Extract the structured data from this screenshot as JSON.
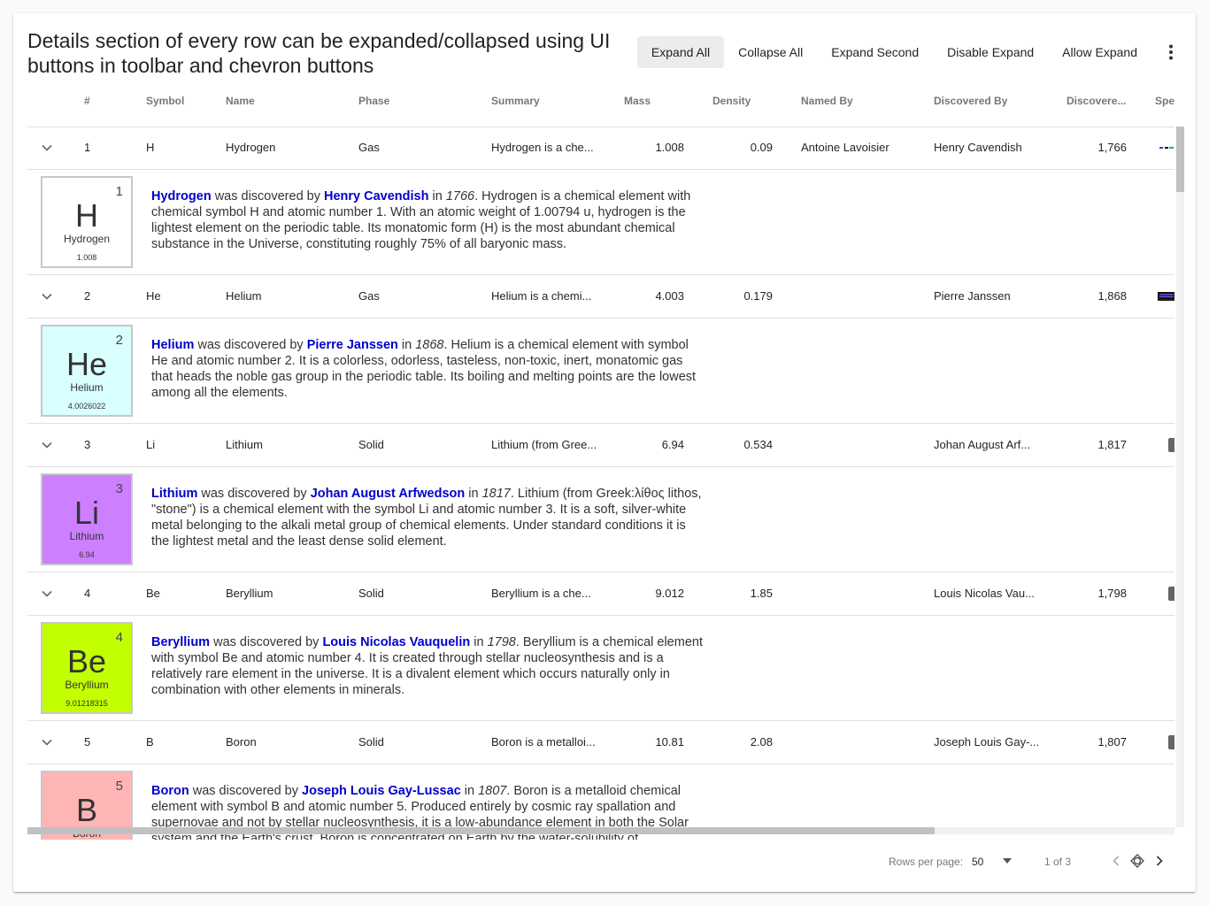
{
  "header": {
    "title": "Details section of every row can be expanded/collapsed using UI buttons in toolbar and chevron buttons"
  },
  "toolbar": {
    "expand_all": "Expand All",
    "collapse_all": "Collapse All",
    "expand_second": "Expand Second",
    "disable_expand": "Disable Expand",
    "allow_expand": "Allow Expand",
    "more_icon": "more-vert-icon"
  },
  "columns": {
    "number": "#",
    "symbol": "Symbol",
    "name": "Name",
    "phase": "Phase",
    "summary": "Summary",
    "mass": "Mass",
    "density": "Density",
    "named_by": "Named By",
    "discovered_by": "Discovered By",
    "discovered": "Discovere...",
    "spectrum": "Spe"
  },
  "rows": [
    {
      "number": "1",
      "symbol": "H",
      "name": "Hydrogen",
      "phase": "Gas",
      "summary": "Hydrogen is a che...",
      "mass": "1.008",
      "density": "0.09",
      "named_by": "Antoine Lavoisier",
      "discovered_by": "Henry Cavendish",
      "year": "1,766",
      "tile": {
        "number": "1",
        "symbol": "H",
        "name": "Hydrogen",
        "mass": "1.008",
        "color": "#ffffff"
      },
      "detail": {
        "element": "Hydrogen",
        "w1": " was discovered by ",
        "discoverer": "Henry Cavendish",
        "w2": " in ",
        "year": "1766",
        "rest": ". Hydrogen is a chemical element with chemical symbol H and atomic number 1. With an atomic weight of 1.00794 u, hydrogen is the lightest element on the periodic table. Its monatomic form (H) is the most abundant chemical substance in the Universe, constituting roughly 75% of all baryonic mass."
      }
    },
    {
      "number": "2",
      "symbol": "He",
      "name": "Helium",
      "phase": "Gas",
      "summary": "Helium is a chemi...",
      "mass": "4.003",
      "density": "0.179",
      "named_by": "",
      "discovered_by": "Pierre Janssen",
      "year": "1,868",
      "tile": {
        "number": "2",
        "symbol": "He",
        "name": "Helium",
        "mass": "4.0026022",
        "color": "#d9ffff"
      },
      "detail": {
        "element": "Helium",
        "w1": " was discovered by ",
        "discoverer": "Pierre Janssen",
        "w2": " in ",
        "year": "1868",
        "rest": ". Helium is a chemical element with symbol He and atomic number 2. It is a colorless, odorless, tasteless, non-toxic, inert, monatomic gas that heads the noble gas group in the periodic table. Its boiling and melting points are the lowest among all the elements."
      }
    },
    {
      "number": "3",
      "symbol": "Li",
      "name": "Lithium",
      "phase": "Solid",
      "summary": "Lithium (from Gree...",
      "mass": "6.94",
      "density": "0.534",
      "named_by": "",
      "discovered_by": "Johan August Arf...",
      "year": "1,817",
      "tile": {
        "number": "3",
        "symbol": "Li",
        "name": "Lithium",
        "mass": "6.94",
        "color": "#cc80ff"
      },
      "detail": {
        "element": "Lithium",
        "w1": " was discovered by ",
        "discoverer": "Johan August Arfwedson",
        "w2": " in ",
        "year": "1817",
        "rest": ". Lithium (from Greek:λίθος lithos, \"stone\") is a chemical element with the symbol Li and atomic number 3. It is a soft, silver-white metal belonging to the alkali metal group of chemical elements. Under standard conditions it is the lightest metal and the least dense solid element."
      }
    },
    {
      "number": "4",
      "symbol": "Be",
      "name": "Beryllium",
      "phase": "Solid",
      "summary": "Beryllium is a che...",
      "mass": "9.012",
      "density": "1.85",
      "named_by": "",
      "discovered_by": "Louis Nicolas Vau...",
      "year": "1,798",
      "tile": {
        "number": "4",
        "symbol": "Be",
        "name": "Beryllium",
        "mass": "9.01218315",
        "color": "#c2ff00"
      },
      "detail": {
        "element": "Beryllium",
        "w1": " was discovered by ",
        "discoverer": "Louis Nicolas Vauquelin",
        "w2": " in ",
        "year": "1798",
        "rest": ". Beryllium is a chemical element with symbol Be and atomic number 4. It is created through stellar nucleosynthesis and is a relatively rare element in the universe. It is a divalent element which occurs naturally only in combination with other elements in minerals."
      }
    },
    {
      "number": "5",
      "symbol": "B",
      "name": "Boron",
      "phase": "Solid",
      "summary": "Boron is a metalloi...",
      "mass": "10.81",
      "density": "2.08",
      "named_by": "",
      "discovered_by": "Joseph Louis Gay-...",
      "year": "1,807",
      "tile": {
        "number": "5",
        "symbol": "B",
        "name": "Boron",
        "mass": "",
        "color": "#ffb5b5"
      },
      "detail": {
        "element": "Boron",
        "w1": " was discovered by ",
        "discoverer": "Joseph Louis Gay-Lussac",
        "w2": " in ",
        "year": "1807",
        "rest": ". Boron is a metalloid chemical element with symbol B and atomic number 5. Produced entirely by cosmic ray spallation and supernovae and not by stellar nucleosynthesis, it is a low-abundance element in both the Solar system and the Earth's crust. Boron is concentrated on Earth by the water-solubility of"
      }
    }
  ],
  "footer": {
    "rows_per_page_label": "Rows per page:",
    "rows_per_page_value": "50",
    "page_info": "1 of 3"
  }
}
